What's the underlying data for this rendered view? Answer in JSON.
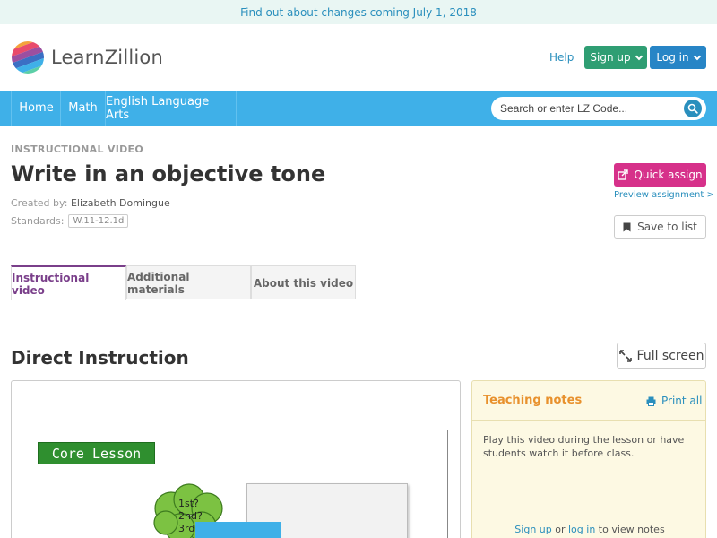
{
  "banner": {
    "text": "Find out about changes coming July 1, 2018"
  },
  "header": {
    "logo_text": "LearnZillion",
    "help": "Help",
    "signup": "Sign up",
    "login": "Log in"
  },
  "nav": {
    "items": [
      "Home",
      "Math",
      "English Language Arts"
    ],
    "search_placeholder": "Search or enter LZ Code..."
  },
  "lesson": {
    "kicker": "INSTRUCTIONAL VIDEO",
    "title": "Write in an objective tone",
    "created_label": "Created by:",
    "created_by": "Elizabeth Domingue",
    "standards_label": "Standards:",
    "standard": "W.11-12.1d"
  },
  "actions": {
    "quick_assign": "Quick assign",
    "preview": "Preview assignment >",
    "save": "Save to list"
  },
  "tabs": [
    {
      "label": "Instructional video",
      "active": true
    },
    {
      "label": "Additional materials",
      "active": false
    },
    {
      "label": "About this video",
      "active": false
    }
  ],
  "section": {
    "title": "Direct Instruction",
    "full_screen": "Full screen"
  },
  "video": {
    "core_label": "Core Lesson",
    "cloud_lines": [
      "1st?",
      "2nd?",
      "3rd?"
    ]
  },
  "notes": {
    "title": "Teaching notes",
    "print": "Print all",
    "body": "Play this video during the lesson or have students watch it before class.",
    "signup": "Sign up",
    "or": " or ",
    "login": "log in",
    "suffix": " to view notes"
  },
  "colors": {
    "nav_blue": "#3fb0e8",
    "signup_green": "#2f9e73",
    "login_blue": "#2785c6",
    "quick_assign_pink": "#d6318a",
    "notes_orange": "#e8912d",
    "tab_active_purple": "#7a3f8a"
  }
}
